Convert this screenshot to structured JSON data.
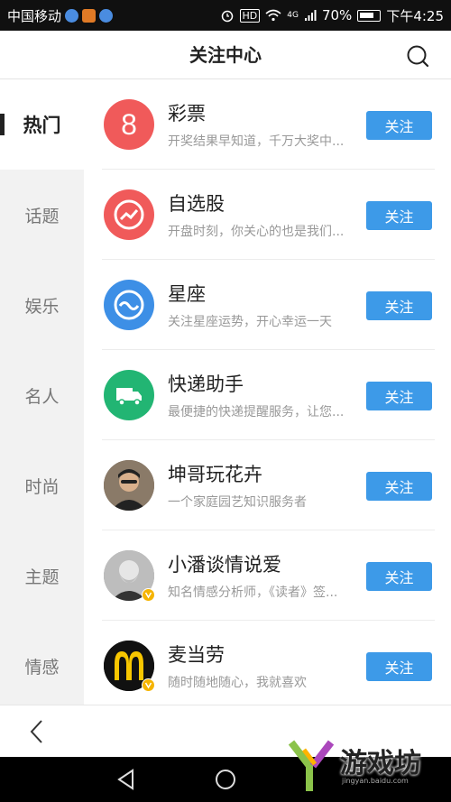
{
  "status_bar": {
    "carrier": "中国移动",
    "signal_label": "4G",
    "hd_label": "HD",
    "battery": "70%",
    "time": "下午4:25"
  },
  "header": {
    "title": "关注中心"
  },
  "sidebar": {
    "items": [
      {
        "label": "热门",
        "active": true
      },
      {
        "label": "话题"
      },
      {
        "label": "娱乐"
      },
      {
        "label": "名人"
      },
      {
        "label": "时尚"
      },
      {
        "label": "主题"
      },
      {
        "label": "情感"
      }
    ]
  },
  "list": {
    "rows": [
      {
        "name": "彩票",
        "desc": "开奖结果早知道，千万大奖中...",
        "button": "关注",
        "avatar_icon": "lottery-8-icon",
        "avatar_color": "#f05a5a"
      },
      {
        "name": "自选股",
        "desc": "开盘时刻，你关心的也是我们...",
        "button": "关注",
        "avatar_icon": "stock-trend-icon",
        "avatar_color": "#f05a5a"
      },
      {
        "name": "星座",
        "desc": "关注星座运势，开心幸运一天",
        "button": "关注",
        "avatar_icon": "zodiac-icon",
        "avatar_color": "#3d8fe6"
      },
      {
        "name": "快递助手",
        "desc": "最便捷的快递提醒服务，让您...",
        "button": "关注",
        "avatar_icon": "delivery-truck-icon",
        "avatar_color": "#22b573"
      },
      {
        "name": "坤哥玩花卉",
        "desc": "一个家庭园艺知识服务者",
        "button": "关注",
        "avatar_icon": "user-photo-avatar",
        "avatar_color": "#6b5a4a"
      },
      {
        "name": "小潘谈情说爱",
        "desc": "知名情感分析师，《读者》签...",
        "button": "关注",
        "avatar_icon": "user-photo-avatar-verified",
        "avatar_color": "#888888"
      },
      {
        "name": "麦当劳",
        "desc": "随时随地随心，我就喜欢",
        "button": "关注",
        "avatar_icon": "mcdonalds-logo-verified",
        "avatar_color": "#111111"
      }
    ]
  },
  "watermark": {
    "text": "游戏坊",
    "sub": "jingyan.baidu.com"
  },
  "colors": {
    "accent": "#3d9ae8",
    "sidebar_bg": "#f2f2f2"
  }
}
